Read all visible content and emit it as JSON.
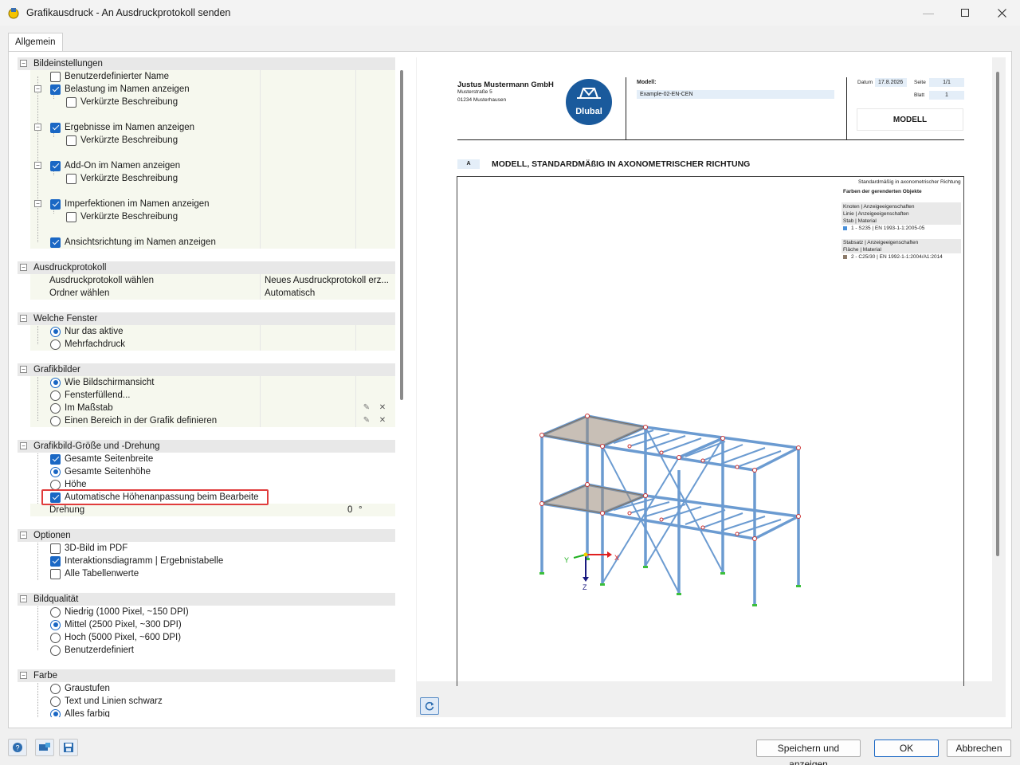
{
  "window": {
    "title": "Grafikausdruck - An Ausdruckprotokoll senden"
  },
  "tabs": [
    {
      "label": "Allgemein"
    }
  ],
  "tree": {
    "bildeinstellungen": {
      "label": "Bildeinstellungen",
      "benutzerdefinierter_name": "Benutzerdefinierter Name",
      "belastung": "Belastung im Namen anzeigen",
      "ergebnisse": "Ergebnisse im Namen anzeigen",
      "addon": "Add-On im Namen anzeigen",
      "imperfektionen": "Imperfektionen im Namen anzeigen",
      "verkuerzte": "Verkürzte Beschreibung",
      "ansichtsrichtung": "Ansichtsrichtung im Namen anzeigen"
    },
    "ausdruckprotokoll": {
      "label": "Ausdruckprotokoll",
      "waehlen_label": "Ausdruckprotokoll wählen",
      "waehlen_value": "Neues Ausdruckprotokoll erz...",
      "ordner_label": "Ordner wählen",
      "ordner_value": "Automatisch"
    },
    "welche_fenster": {
      "label": "Welche Fenster",
      "nur_aktive": "Nur das aktive",
      "mehrfach": "Mehrfachdruck"
    },
    "grafikbilder": {
      "label": "Grafikbilder",
      "wie_bildschirm": "Wie Bildschirmansicht",
      "fensterfuellend": "Fensterfüllend...",
      "massstab": "Im Maßstab",
      "bereich": "Einen Bereich in der Grafik definieren"
    },
    "groesse": {
      "label": "Grafikbild-Größe und -Drehung",
      "seitenbreite": "Gesamte Seitenbreite",
      "seitenhoehe": "Gesamte Seitenhöhe",
      "hoehe": "Höhe",
      "auto_hoehe": "Automatische Höhenanpassung beim Bearbeite",
      "drehung_label": "Drehung",
      "drehung_value": "0",
      "drehung_unit": "°"
    },
    "optionen": {
      "label": "Optionen",
      "pdf3d": "3D-Bild im PDF",
      "interaktion": "Interaktionsdiagramm | Ergebnistabelle",
      "tabellen": "Alle Tabellenwerte"
    },
    "bildqualitaet": {
      "label": "Bildqualität",
      "niedrig": "Niedrig (1000 Pixel, ~150 DPI)",
      "mittel": "Mittel (2500 Pixel, ~300 DPI)",
      "hoch": "Hoch (5000 Pixel, ~600 DPI)",
      "benutzer": "Benutzerdefiniert"
    },
    "farbe": {
      "label": "Farbe",
      "graustufen": "Graustufen",
      "text_schwarz": "Text und Linien schwarz",
      "alles_farbig": "Alles farbig"
    }
  },
  "preview": {
    "company": "Justus Mustermann GmbH",
    "street": "Musterstraße 5",
    "city": "01234 Musterhausen",
    "logo_text": "Dlubal",
    "modell_label": "Modell:",
    "modell_value": "Example-02-EN-CEN",
    "datum_label": "Datum",
    "datum_value": "17.8.2026",
    "seite_label": "Seite",
    "seite_value": "1/1",
    "blatt_label": "Blatt",
    "blatt_value": "1",
    "modell_box": "MODELL",
    "section_letter": "A",
    "section_title": "MODELL, STANDARDMÄßIG IN AXONOMETRISCHER RICHTUNG",
    "legend": {
      "l1": "Standardmäßig in axonometrischer Richtung",
      "l2": "Farben der gerenderten Objekte",
      "l3": "Knoten | Anzeigeeigenschaften",
      "l4": "Linie | Anzeigeeigenschaften",
      "l5": "Stab | Material",
      "l6": "1 - S235 | EN 1993-1-1:2005-05",
      "l7": "Stabsatz | Anzeigeeigenschaften",
      "l8": "Fläche | Material",
      "l9": "2 - C25/30 | EN 1992-1-1:2004/A1:2014"
    },
    "axes": {
      "x": "X",
      "y": "Y",
      "z": "Z"
    },
    "colors": {
      "steel": "#4a90d9",
      "concrete": "#8c7b6b"
    }
  },
  "buttons": {
    "save_show": "Speichern und anzeigen",
    "ok": "OK",
    "cancel": "Abbrechen"
  }
}
